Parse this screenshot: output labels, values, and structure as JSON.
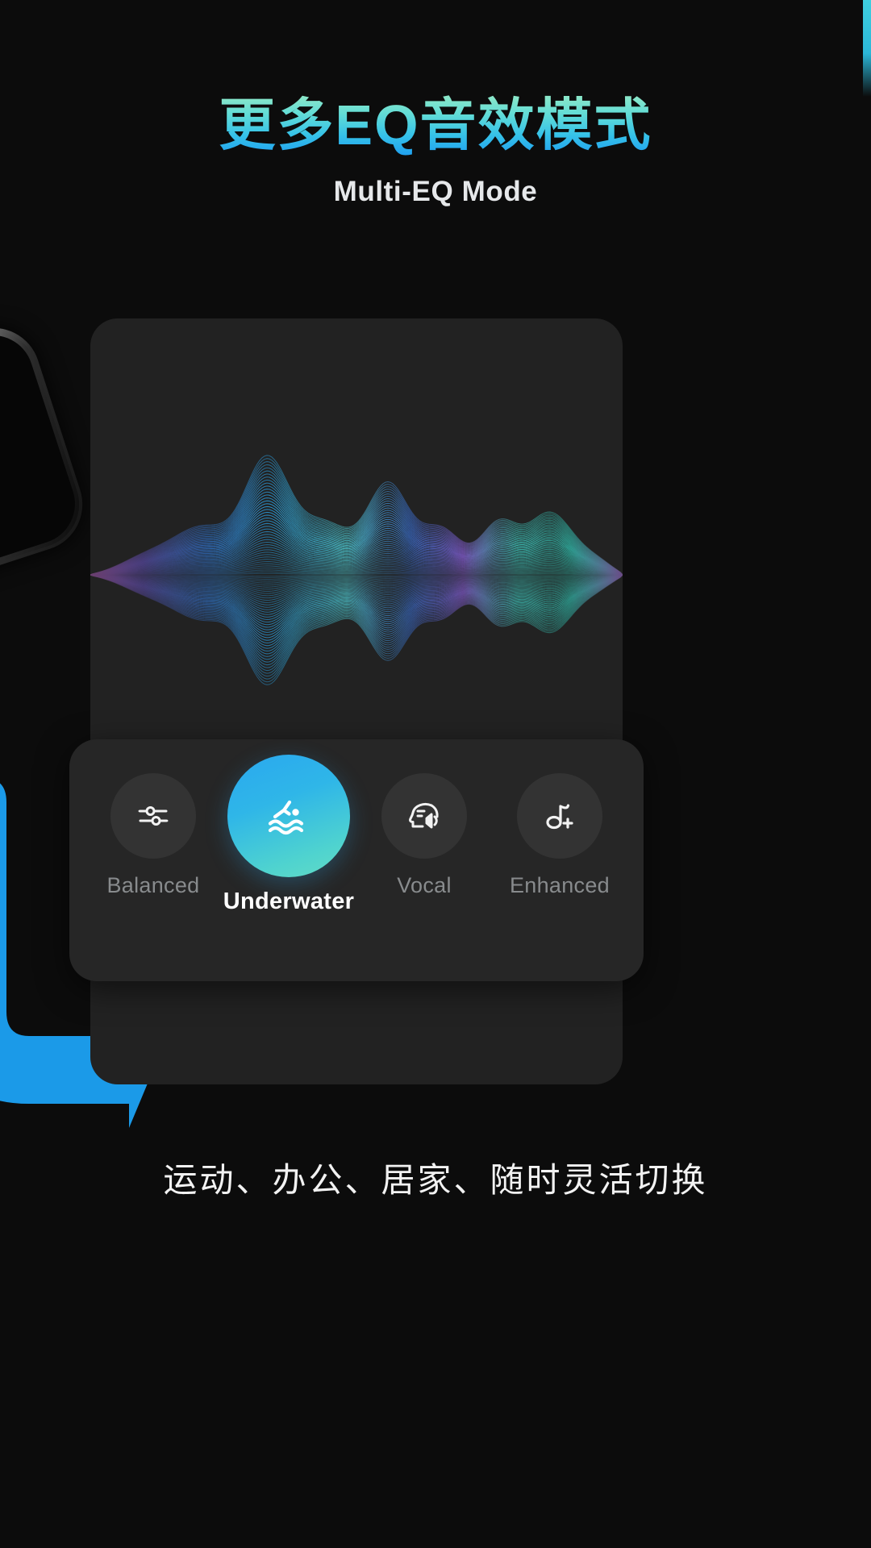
{
  "header": {
    "title": "更多EQ音效模式",
    "subtitle": "Multi-EQ Mode",
    "title_gradient_from": "#8ee8c8",
    "title_gradient_to": "#1f9ff0"
  },
  "eq_card": {
    "background": "#222222",
    "waveform_label": "audio-waveform-visualization"
  },
  "mode_panel": {
    "background": "#262626",
    "active_gradient_from": "#2aa8ef",
    "active_gradient_to": "#63dcc5",
    "modes": [
      {
        "label": "Balanced",
        "icon": "equalizer-sliders-icon",
        "active": false
      },
      {
        "label": "Underwater",
        "icon": "swimmer-icon",
        "active": true
      },
      {
        "label": "Vocal",
        "icon": "head-speaker-icon",
        "active": false
      },
      {
        "label": "Enhanced",
        "icon": "music-note-plus-icon",
        "active": false
      }
    ]
  },
  "caption": {
    "text": "运动、办公、居家、随时灵活切换"
  },
  "decoration": {
    "arrow_color": "#1b9ae8",
    "edge_strip_color": "#3fd0e0"
  }
}
